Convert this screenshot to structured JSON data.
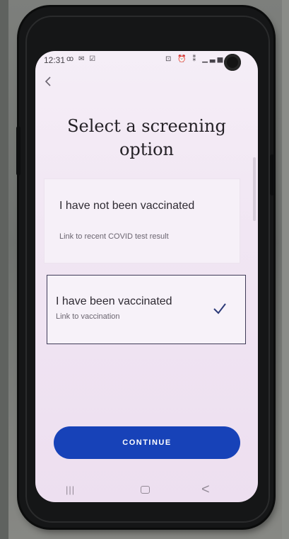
{
  "status_bar": {
    "time": "12:31",
    "left_icons": [
      "voicemail-icon",
      "mail-icon",
      "calendar-check-icon"
    ],
    "right_icons": [
      "lock-icon",
      "alarm-icon",
      "mute-icon",
      "signal-icon",
      "battery-icon"
    ]
  },
  "header": {
    "back_icon": "chevron-left-icon",
    "title": "Select a screening option"
  },
  "options": [
    {
      "title": "I have not been vaccinated",
      "subtitle": "Link to recent COVID test result",
      "selected": false
    },
    {
      "title": "I have been vaccinated",
      "subtitle": "Link to vaccination",
      "selected": true
    }
  ],
  "continue": {
    "label": "CONTINUE"
  },
  "nav_bar": {
    "recent": "|||",
    "back": "<"
  },
  "colors": {
    "primary_button": "#1742b8",
    "selected_border": "#3f3b58",
    "screen_tint": "#f1e6f3"
  }
}
